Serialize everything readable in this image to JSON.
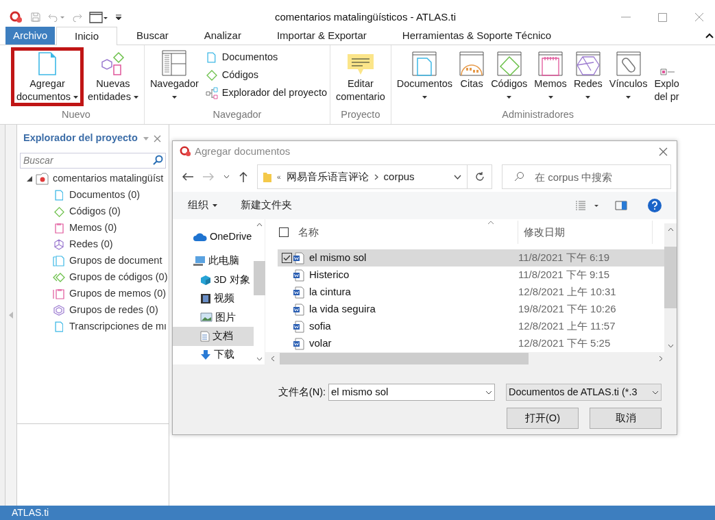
{
  "window": {
    "title": "comentarios matalingüísticos - ATLAS.ti"
  },
  "ribbon_tabs": [
    {
      "label": "Archivo",
      "kind": "file",
      "selected": false
    },
    {
      "label": "Inicio",
      "kind": "tab",
      "selected": true
    },
    {
      "label": "Buscar",
      "kind": "tab",
      "selected": false
    },
    {
      "label": "Analizar",
      "kind": "tab",
      "selected": false
    },
    {
      "label": "Importar & Exportar",
      "kind": "tab",
      "selected": false
    },
    {
      "label": "Herramientas & Soporte Técnico",
      "kind": "tab",
      "selected": false
    }
  ],
  "ribbon_groups": [
    {
      "label": "Nuevo",
      "items": [
        {
          "kind": "large",
          "lines": [
            "Agregar",
            "documentos"
          ],
          "dropdown": true,
          "highlighted": true
        },
        {
          "kind": "large",
          "lines": [
            "Nuevas",
            "entidades"
          ],
          "dropdown": true,
          "highlighted": false
        }
      ]
    },
    {
      "label": "Navegador",
      "items": [
        {
          "kind": "large",
          "lines": [
            "Navegador"
          ],
          "dropdown": true,
          "highlighted": false
        },
        {
          "kind": "small",
          "lines": [
            "Documentos"
          ]
        },
        {
          "kind": "small",
          "lines": [
            "Códigos"
          ]
        },
        {
          "kind": "small",
          "lines": [
            "Explorador del proyecto"
          ]
        }
      ]
    },
    {
      "label": "Proyecto",
      "items": [
        {
          "kind": "large",
          "lines": [
            "Editar",
            "comentario"
          ],
          "dropdown": false,
          "highlighted": false
        }
      ]
    },
    {
      "label": "Administradores",
      "items": [
        {
          "kind": "large",
          "lines": [
            "Documentos"
          ],
          "dropdown": true,
          "highlighted": false
        },
        {
          "kind": "large",
          "lines": [
            "Citas"
          ],
          "dropdown": false,
          "highlighted": false
        },
        {
          "kind": "large",
          "lines": [
            "Códigos"
          ],
          "dropdown": true,
          "highlighted": false
        },
        {
          "kind": "large",
          "lines": [
            "Memos"
          ],
          "dropdown": true,
          "highlighted": false
        },
        {
          "kind": "large",
          "lines": [
            "Redes"
          ],
          "dropdown": true,
          "highlighted": false
        },
        {
          "kind": "large",
          "lines": [
            "Vínculos"
          ],
          "dropdown": true,
          "highlighted": false
        },
        {
          "kind": "large",
          "lines": [
            "Explo",
            "del pr"
          ],
          "dropdown": false,
          "highlighted": false
        }
      ]
    }
  ],
  "explorer": {
    "title": "Explorador del proyecto",
    "search": {
      "placeholder": "Buscar"
    },
    "tree": [
      {
        "label": "comentarios matalingüíst",
        "expanded": true,
        "children": [
          {
            "label": "Documentos (0)"
          },
          {
            "label": "Códigos (0)"
          },
          {
            "label": "Memos (0)"
          },
          {
            "label": "Redes (0)"
          },
          {
            "label": "Grupos de document"
          },
          {
            "label": "Grupos de códigos (0)"
          },
          {
            "label": "Grupos de memos (0)"
          },
          {
            "label": "Grupos de redes (0)"
          },
          {
            "label": "Transcripciones de mı"
          }
        ]
      }
    ]
  },
  "dialog": {
    "title": "Agregar documentos",
    "breadcrumb_overflow": "«",
    "breadcrumb": [
      "网易音乐语言评论",
      "corpus"
    ],
    "all_checked": false,
    "search": {
      "placeholder": "在 corpus 中搜索"
    },
    "toolbar": [
      "组织",
      "新建文件夹"
    ],
    "nav_items": [
      {
        "label": "OneDrive",
        "selected": false
      },
      {
        "label": "此电脑",
        "selected": false
      },
      {
        "label": "3D 对象",
        "selected": false
      },
      {
        "label": "视频",
        "selected": false
      },
      {
        "label": "图片",
        "selected": false
      },
      {
        "label": "文档",
        "selected": true
      },
      {
        "label": "下载",
        "selected": false
      }
    ],
    "columns": [
      "名称",
      "修改日期"
    ],
    "files": [
      {
        "name": "el mismo sol",
        "modified": "11/8/2021 下午 6:19",
        "selected": true,
        "checked": true
      },
      {
        "name": "Histerico",
        "modified": "11/8/2021 下午 9:15",
        "selected": false,
        "checked": false
      },
      {
        "name": "la cintura",
        "modified": "12/8/2021 上午 10:31",
        "selected": false,
        "checked": false
      },
      {
        "name": "la vida seguira",
        "modified": "19/8/2021 下午 10:26",
        "selected": false,
        "checked": false
      },
      {
        "name": "sofia",
        "modified": "12/8/2021 上午 11:57",
        "selected": false,
        "checked": false
      },
      {
        "name": "volar",
        "modified": "12/8/2021 下午 5:25",
        "selected": false,
        "checked": false
      }
    ],
    "filename_label": "文件名(N):",
    "filename": "el mismo sol",
    "filter": "Documentos de ATLAS.ti (*.3",
    "buttons": [
      "打开(O)",
      "取消"
    ]
  },
  "status_bar": "ATLAS.ti"
}
